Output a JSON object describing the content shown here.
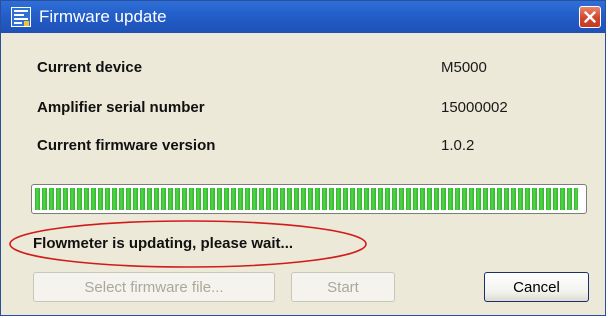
{
  "window": {
    "title": "Firmware update"
  },
  "info": [
    {
      "label": "Current device",
      "value": "M5000"
    },
    {
      "label": "Amplifier serial number",
      "value": "15000002"
    },
    {
      "label": "Current firmware version",
      "value": "1.0.2"
    }
  ],
  "progress": {
    "fraction": 0.99,
    "color": "#2fb52a"
  },
  "status": {
    "text": "Flowmeter is updating, please wait...",
    "highlight_color": "#d11a1a"
  },
  "buttons": {
    "select_label": "Select firmware file...",
    "start_label": "Start",
    "cancel_label": "Cancel"
  },
  "colors": {
    "titlebar": "#235ec9",
    "close_button": "#d2452b",
    "window_background": "#ece9d8"
  },
  "icons": {
    "app": "firmware-app-icon",
    "close": "close-icon"
  }
}
